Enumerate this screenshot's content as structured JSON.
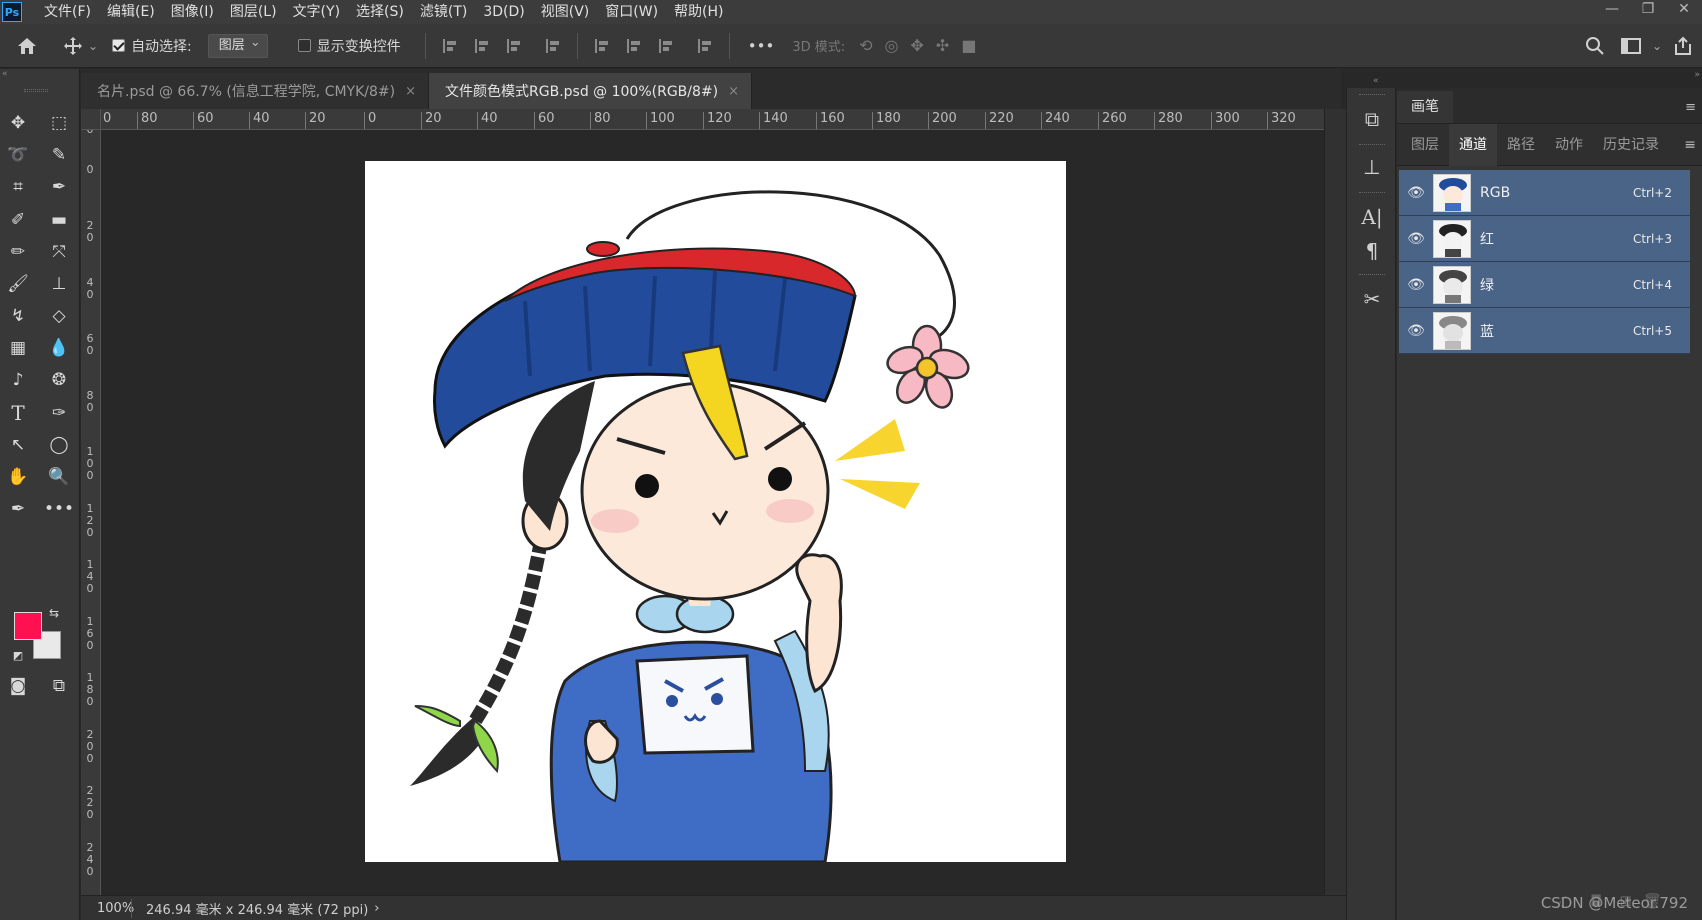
{
  "app": {
    "logo": "Ps"
  },
  "menu": [
    "文件(F)",
    "编辑(E)",
    "图像(I)",
    "图层(L)",
    "文字(Y)",
    "选择(S)",
    "滤镜(T)",
    "3D(D)",
    "视图(V)",
    "窗口(W)",
    "帮助(H)"
  ],
  "window_controls": {
    "minimize": "—",
    "restore": "❐",
    "close": "✕"
  },
  "options": {
    "auto_select_label": "自动选择:",
    "auto_select_checked": true,
    "target_value": "图层",
    "show_transform_label": "显示变换控件",
    "show_transform_checked": false,
    "more": "•••",
    "mode_3d_label": "3D 模式:"
  },
  "tabs": [
    {
      "label": "名片.psd @ 66.7% (信息工程学院, CMYK/8#)",
      "active": false,
      "close": "×"
    },
    {
      "label": "文件颜色模式RGB.psd @ 100%(RGB/8#)",
      "active": true,
      "close": "×"
    }
  ],
  "ruler_h": [
    "0",
    "80",
    "60",
    "40",
    "20",
    "0",
    "20",
    "40",
    "60",
    "80",
    "100",
    "120",
    "140",
    "160",
    "180",
    "200",
    "220",
    "240",
    "260",
    "280",
    "300",
    "320"
  ],
  "ruler_v": [
    "0",
    "0",
    "2\n0",
    "4\n0",
    "6\n0",
    "8\n0",
    "1\n0\n0",
    "1\n2\n0",
    "1\n4\n0",
    "1\n6\n0",
    "1\n8\n0",
    "2\n0\n0",
    "2\n2\n0",
    "2\n4\n0"
  ],
  "colors": {
    "foreground": "#ff1050",
    "background": "#e9e9e9",
    "channel_highlight": "#4a6488"
  },
  "status": {
    "zoom": "100%",
    "doc_size": "246.94 毫米 x 246.94 毫米 (72 ppi)",
    "arrow": "›"
  },
  "panel": {
    "header_tab": "画笔",
    "tabs": [
      "图层",
      "通道",
      "路径",
      "动作",
      "历史记录"
    ],
    "active_tab": "通道",
    "channels": [
      {
        "name": "RGB",
        "shortcut": "Ctrl+2"
      },
      {
        "name": "红",
        "shortcut": "Ctrl+3"
      },
      {
        "name": "绿",
        "shortcut": "Ctrl+4"
      },
      {
        "name": "蓝",
        "shortcut": "Ctrl+5"
      }
    ]
  },
  "watermark": "CSDN @Meteor.792"
}
